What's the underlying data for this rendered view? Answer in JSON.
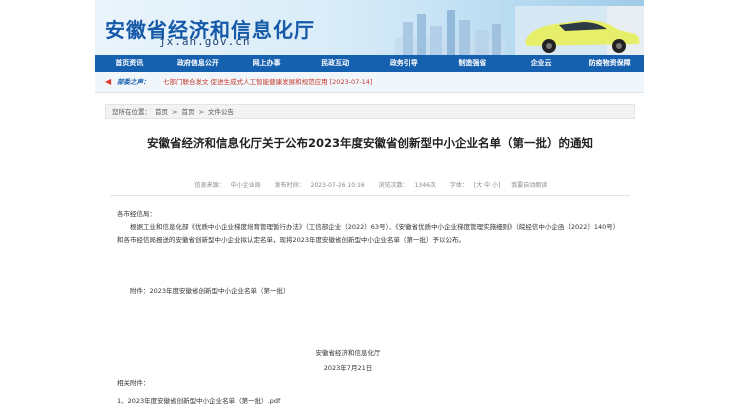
{
  "header": {
    "title": "安徽省经济和信息化厅",
    "domain": "jx.ah.gov.cn"
  },
  "nav": [
    {
      "label": "首页资讯"
    },
    {
      "label": "政府信息公开"
    },
    {
      "label": "网上办事"
    },
    {
      "label": "民政互动"
    },
    {
      "label": "政务引导"
    },
    {
      "label": "制造强省"
    },
    {
      "label": "企业云"
    },
    {
      "label": "防疫物资保障"
    }
  ],
  "notice": {
    "label": "部委之声：",
    "text": "七部门联合发文 促进生成式人工智能健康发展和规范应用 [2023-07-14]"
  },
  "breadcrumb": {
    "prefix": "您所在位置：",
    "home": "首页",
    "sep1": ">",
    "section": "首页",
    "sep2": ">",
    "current": "文件公告"
  },
  "article": {
    "title": "安徽省经济和信息化厅关于公布2023年度安徽省创新型中小企业名单（第一批）的通知",
    "source_label": "信息来源：",
    "source": "中小企业局",
    "date_label": "发布时间：",
    "date": "2023-07-26 10:16",
    "views_label": "浏览次数：",
    "views": "1346次",
    "font_label": "字体：",
    "font_options": "[大 中 小]",
    "tts": "我要自动朗读",
    "salutation": "各市经信局：",
    "paragraph": "根据工业和信息化部《优质中小企业梯度培育管理暂行办法》（工信部企业〔2022〕63号）、《安徽省优质中小企业梯度管理实施细则》（皖经信中小企函〔2022〕140号）和各市经信局报送的安徽省创新型中小企业拟认定名单，现将2023年度安徽省创新型中小企业名单（第一批）予以公布。",
    "attachment": "附件：2023年度安徽省创新型中小企业名单（第一批）",
    "signer": "安徽省经济和信息化厅",
    "sign_date": "2023年7月21日",
    "related_label": "相关附件：",
    "file": "1、2023年度安徽省创新型中小企业名单（第一批）.pdf"
  },
  "colors": {
    "brand": "#1660b0",
    "notice_text": "#c53a2b"
  }
}
